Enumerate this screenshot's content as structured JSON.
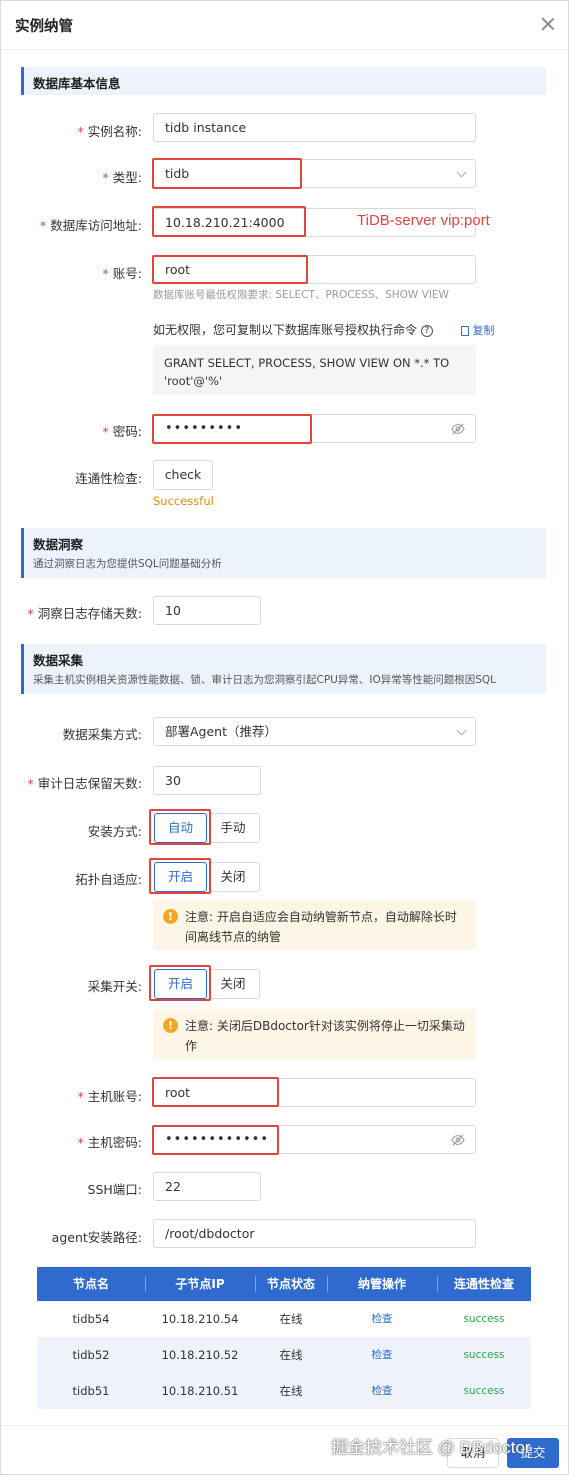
{
  "dialog": {
    "title": "实例纳管"
  },
  "basic": {
    "section_title": "数据库基本信息",
    "instance_name": {
      "label": "实例名称:",
      "value": "tidb instance"
    },
    "type": {
      "label": "类型:",
      "value": "tidb"
    },
    "address": {
      "label": "数据库访问地址:",
      "value": "10.18.210.21:4000",
      "annotation": "TiDB-server vip:port"
    },
    "account": {
      "label": "账号:",
      "value": "root",
      "hint": "数据库账号最低权限要求: SELECT、PROCESS、SHOW VIEW"
    },
    "grant_note": "如无权限，您可复制以下数据库账号授权执行命令",
    "copy_label": "复制",
    "grant_sql_1": "GRANT SELECT, PROCESS, SHOW VIEW ON *.* TO",
    "grant_sql_2": "'root'@'%'",
    "password": {
      "label": "密码:",
      "value": "•••••••••"
    },
    "connectivity": {
      "label": "连通性检查:",
      "button": "check",
      "result": "Successful"
    }
  },
  "insight": {
    "section_title": "数据洞察",
    "section_desc": "通过洞察日志为您提供SQL问题基础分析",
    "retention": {
      "label": "洞察日志存储天数:",
      "value": "10"
    }
  },
  "collect": {
    "section_title": "数据采集",
    "section_desc": "采集主机实例相关资源性能数据、锁、审计日志为您洞察引起CPU异常、IO异常等性能问题根因SQL",
    "method": {
      "label": "数据采集方式:",
      "value": "部署Agent（推荐）"
    },
    "audit_days": {
      "label": "审计日志保留天数:",
      "value": "30"
    },
    "install": {
      "label": "安装方式:",
      "opt1": "自动",
      "opt2": "手动"
    },
    "topology": {
      "label": "拓扑自适应:",
      "opt1": "开启",
      "opt2": "关闭",
      "warn_prefix": "注意: ",
      "warn": "开启自适应会自动纳管新节点，自动解除长时间离线节点的纳管"
    },
    "switch": {
      "label": "采集开关:",
      "opt1": "开启",
      "opt2": "关闭",
      "warn_prefix": "注意: ",
      "warn": "关闭后DBdoctor针对该实例将停止一切采集动作"
    },
    "host_account": {
      "label": "主机账号:",
      "value": "root"
    },
    "host_password": {
      "label": "主机密码:",
      "value": "••••••••••••"
    },
    "ssh_port": {
      "label": "SSH端口:",
      "value": "22"
    },
    "agent_path": {
      "label": "agent安装路径:",
      "value": "/root/dbdoctor"
    }
  },
  "table": {
    "headers": [
      "节点名",
      "子节点IP",
      "节点状态",
      "纳管操作",
      "连通性检查"
    ],
    "rows": [
      {
        "name": "tidb54",
        "ip": "10.18.210.54",
        "status": "在线",
        "action": "检查",
        "check": "success"
      },
      {
        "name": "tidb52",
        "ip": "10.18.210.52",
        "status": "在线",
        "action": "检查",
        "check": "success"
      },
      {
        "name": "tidb51",
        "ip": "10.18.210.51",
        "status": "在线",
        "action": "检查",
        "check": "success"
      }
    ]
  },
  "footer": {
    "cancel": "取消",
    "submit": "提交"
  },
  "watermark": "掘金技术社区 @ DBdoctor"
}
